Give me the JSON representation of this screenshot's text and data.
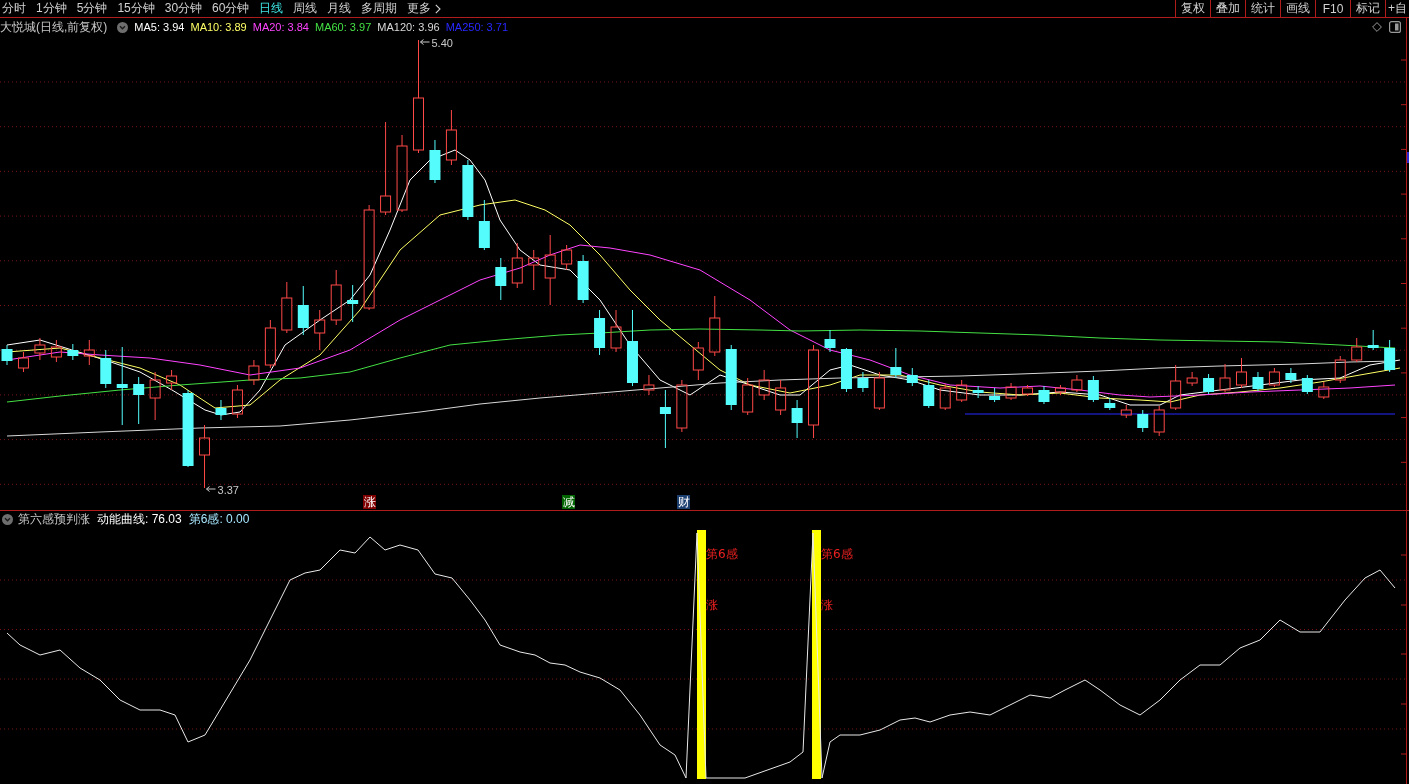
{
  "toolbar": {
    "periods": [
      {
        "label": "分时",
        "selected": false,
        "kind": "period"
      },
      {
        "label": "1分钟",
        "selected": false,
        "kind": "period"
      },
      {
        "label": "5分钟",
        "selected": false,
        "kind": "period"
      },
      {
        "label": "15分钟",
        "selected": false,
        "kind": "period"
      },
      {
        "label": "30分钟",
        "selected": false,
        "kind": "period"
      },
      {
        "label": "60分钟",
        "selected": false,
        "kind": "period"
      },
      {
        "label": "日线",
        "selected": true,
        "kind": "period"
      },
      {
        "label": "周线",
        "selected": false,
        "kind": "period"
      },
      {
        "label": "月线",
        "selected": false,
        "kind": "period"
      },
      {
        "label": "多周期",
        "selected": false,
        "kind": "period"
      },
      {
        "label": "更多",
        "selected": false,
        "kind": "menu"
      }
    ],
    "buttons": [
      "复权",
      "叠加",
      "统计",
      "画线",
      "F10",
      "标记",
      "+自"
    ]
  },
  "main_chart": {
    "title": "大悦城(日线,前复权)",
    "moving_averages": [
      {
        "label": "MA5: 3.94",
        "color": "#ffffff"
      },
      {
        "label": "MA10: 3.89",
        "color": "#ffff66"
      },
      {
        "label": "MA20: 3.84",
        "color": "#ff44ff"
      },
      {
        "label": "MA60: 3.97",
        "color": "#44e044"
      },
      {
        "label": "MA120: 3.96",
        "color": "#d8d8d8"
      },
      {
        "label": "MA250: 3.71",
        "color": "#2828ff"
      }
    ],
    "high_label": "5.40",
    "low_label": "3.37",
    "event_markers": [
      {
        "label": "涨",
        "color": "#800000"
      },
      {
        "label": "减",
        "color": "#006400"
      },
      {
        "label": "财",
        "color": "#1c3f70"
      }
    ]
  },
  "indicator": {
    "title": "第六感预判涨",
    "values": [
      {
        "label": "动能曲线: 76.03",
        "color": "#ffffff"
      },
      {
        "label": "第6感: 0.00",
        "color": "#a8e8ff"
      }
    ],
    "signals": [
      {
        "label": "第6感",
        "mark": "涨"
      },
      {
        "label": "第6感",
        "mark": "涨"
      }
    ]
  }
}
